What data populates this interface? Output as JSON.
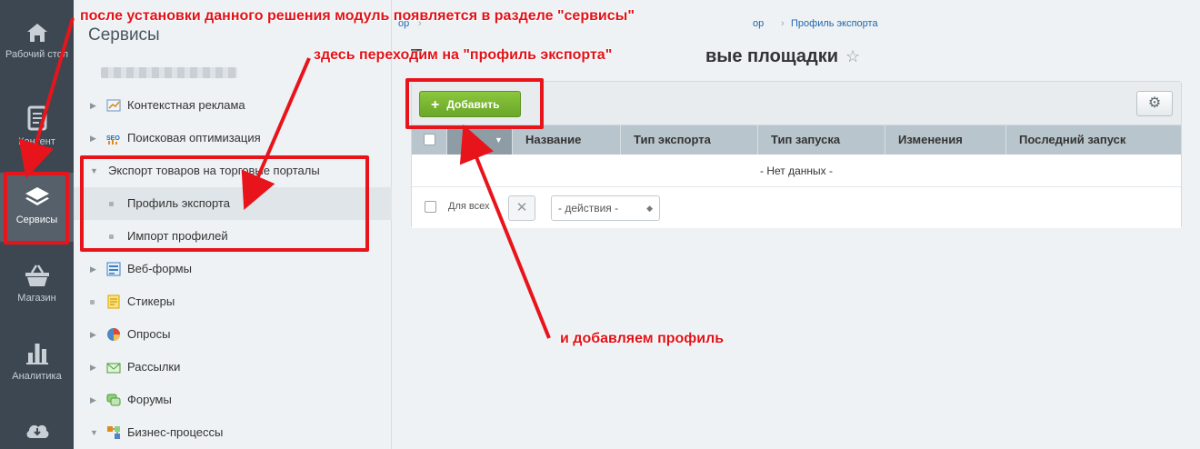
{
  "left_nav": [
    {
      "label": "Рабочий стол",
      "icon": "home-icon"
    },
    {
      "label": "Контент",
      "icon": "document-icon"
    },
    {
      "label": "Сервисы",
      "icon": "layers-icon"
    },
    {
      "label": "Магазин",
      "icon": "basket-icon"
    },
    {
      "label": "Аналитика",
      "icon": "bar-chart-icon"
    },
    {
      "label": "",
      "icon": "cloud-download-icon"
    }
  ],
  "secondary": {
    "title": "Сервисы",
    "items": [
      {
        "label": "Контекстная реклама",
        "icon": "chart-line-icon"
      },
      {
        "label": "Поисковая оптимизация",
        "icon": "seo-icon"
      },
      {
        "label": "Экспорт товаров на торговые порталы",
        "icon": ""
      },
      {
        "label": "Профиль экспорта",
        "icon": ""
      },
      {
        "label": "Импорт профилей",
        "icon": ""
      },
      {
        "label": "Веб-формы",
        "icon": "form-icon"
      },
      {
        "label": "Стикеры",
        "icon": "sticker-icon"
      },
      {
        "label": "Опросы",
        "icon": "pie-icon"
      },
      {
        "label": "Рассылки",
        "icon": "envelope-icon"
      },
      {
        "label": "Форумы",
        "icon": "forum-icon"
      },
      {
        "label": "Бизнес-процессы",
        "icon": "process-icon"
      }
    ]
  },
  "main": {
    "breadcrumb_tail": "Профиль экспорта",
    "title_tail": "вые площадки",
    "add_label": "Добавить",
    "columns": [
      "Название",
      "Тип экспорта",
      "Тип запуска",
      "Изменения",
      "Последний запуск"
    ],
    "empty_text": "- Нет данных -",
    "for_all": "Для всех",
    "actions_select": "- действия -"
  },
  "annotations": {
    "top": "после установки данного решения модуль появляется в разделе \"сервисы\"",
    "middle": "здесь переходим на \"профиль экспорта\"",
    "bottom": "и добавляем профиль"
  },
  "colors": {
    "annotation": "#e11219",
    "add_button": "#7db834",
    "left_nav_bg": "#3d4751"
  }
}
